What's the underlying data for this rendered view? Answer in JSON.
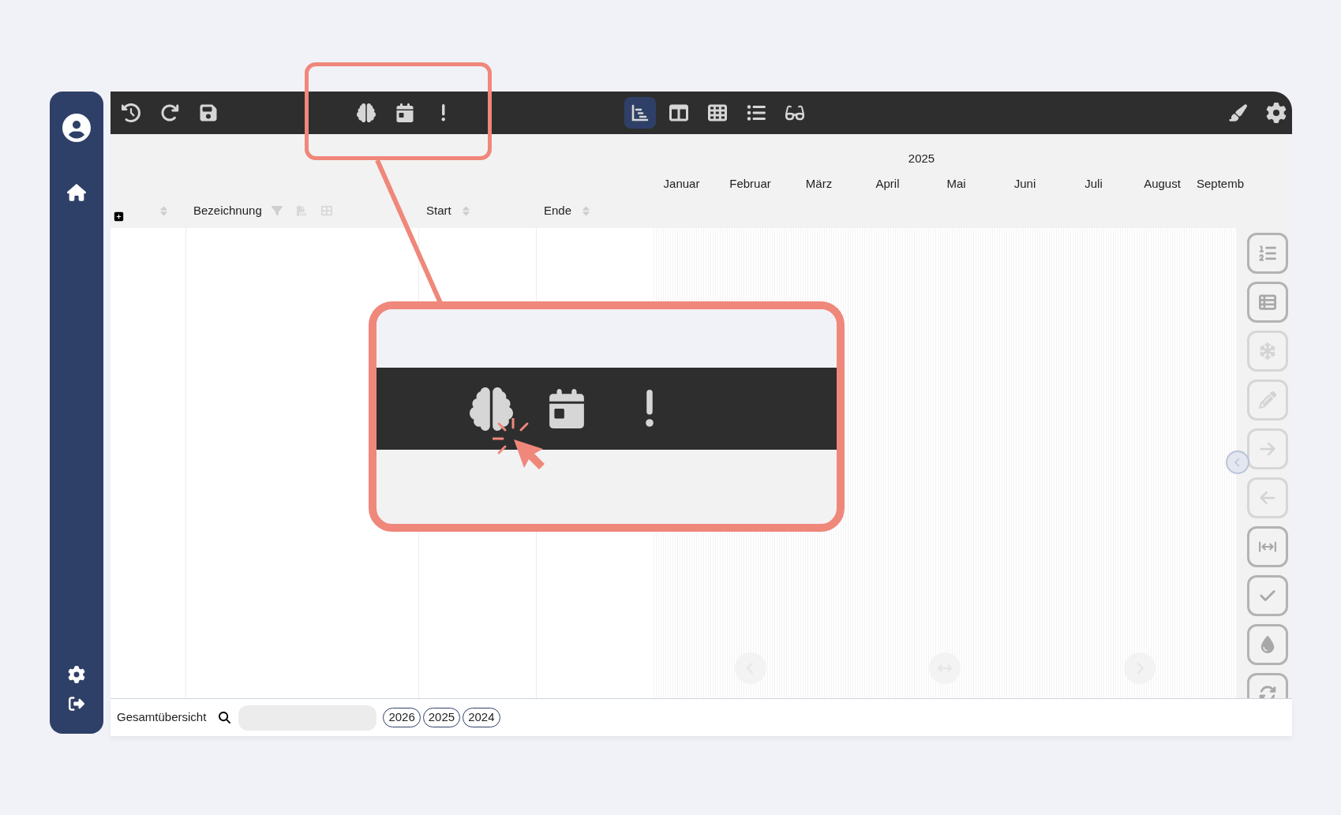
{
  "toolbar": {
    "view_buttons": [
      {
        "selected": true
      },
      {
        "selected": false
      },
      {
        "selected": false
      },
      {
        "selected": false
      },
      {
        "selected": false
      }
    ]
  },
  "timeline": {
    "year": "2025",
    "months": [
      "Januar",
      "Februar",
      "März",
      "April",
      "Mai",
      "Juni",
      "Juli",
      "August",
      "Septemb"
    ]
  },
  "columns": [
    {
      "label": "Bezeichnung"
    },
    {
      "label": "Start"
    },
    {
      "label": "Ende"
    }
  ],
  "side_tools": [
    {
      "disabled": false
    },
    {
      "disabled": false
    },
    {
      "disabled": true
    },
    {
      "disabled": true
    },
    {
      "disabled": true
    },
    {
      "disabled": true
    },
    {
      "disabled": false
    },
    {
      "disabled": false
    },
    {
      "disabled": false
    },
    {
      "disabled": false
    }
  ],
  "footer": {
    "title": "Gesamtübersicht",
    "years": [
      "2026",
      "2025",
      "2024"
    ]
  }
}
